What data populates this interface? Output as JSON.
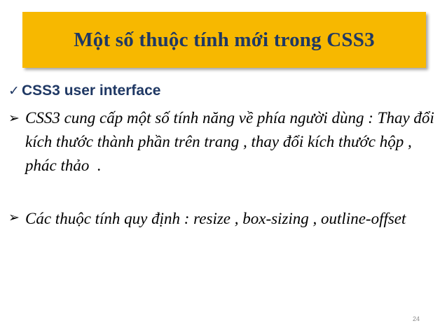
{
  "slide": {
    "title": "Một số thuộc tính mới trong CSS3",
    "heading": {
      "icon": "checkmark-icon",
      "text": "CSS3 user interface"
    },
    "bullets": [
      {
        "icon": "arrow-bullet-icon",
        "text": "CSS3 cung cấp một số tính năng về phía người dùng : Thay đổi kích thước thành phần trên trang , thay đổi kích thước hộp , phác thảo  ."
      },
      {
        "icon": "arrow-bullet-icon",
        "text": "Các thuộc tính quy định : resize , box-sizing , outline-offset"
      }
    ],
    "page_number": "24",
    "colors": {
      "title_background": "#f7b800",
      "title_text": "#1f3864",
      "heading_text": "#1f3864",
      "body_text": "#000000"
    }
  }
}
